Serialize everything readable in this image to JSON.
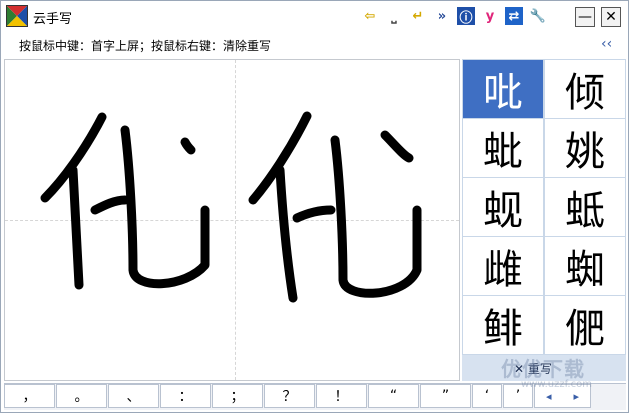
{
  "window": {
    "title": "云手写",
    "hint": "按鼠标中键：首字上屏；按鼠标右键：清除重写",
    "collapse": "‹‹"
  },
  "toolbar": [
    {
      "name": "back-arrow-icon",
      "glyph": "⇦",
      "color": "#d4a800"
    },
    {
      "name": "space-icon",
      "glyph": "⎵",
      "color": "#444444"
    },
    {
      "name": "enter-icon",
      "glyph": "↵",
      "color": "#d4a800"
    },
    {
      "name": "forward-icon",
      "glyph": "»",
      "color": "#2c4f9a"
    },
    {
      "name": "info-icon",
      "glyph": "ⓘ",
      "color": "#2c4f9a"
    },
    {
      "name": "yahoo-icon",
      "glyph": "y",
      "color": "#e0257a"
    },
    {
      "name": "switch-icon",
      "glyph": "⇄",
      "color": "#ffffff"
    },
    {
      "name": "wrench-icon",
      "glyph": "🔧",
      "color": "#333333"
    }
  ],
  "candidates": [
    "吡",
    "倾",
    "蚍",
    "姚",
    "蚬",
    "蚳",
    "雌",
    "蜘",
    "鲱",
    "俷"
  ],
  "selected_index": 0,
  "rewrite_label": "✕ 重写",
  "punctuation": [
    "，",
    "。",
    "、",
    "：",
    "；",
    "？",
    "！",
    "“",
    "”",
    "‘",
    "’"
  ],
  "pager": [
    "◂",
    "▸"
  ],
  "watermark": {
    "main": "优优下载",
    "sub": "www.uzzf.com"
  }
}
